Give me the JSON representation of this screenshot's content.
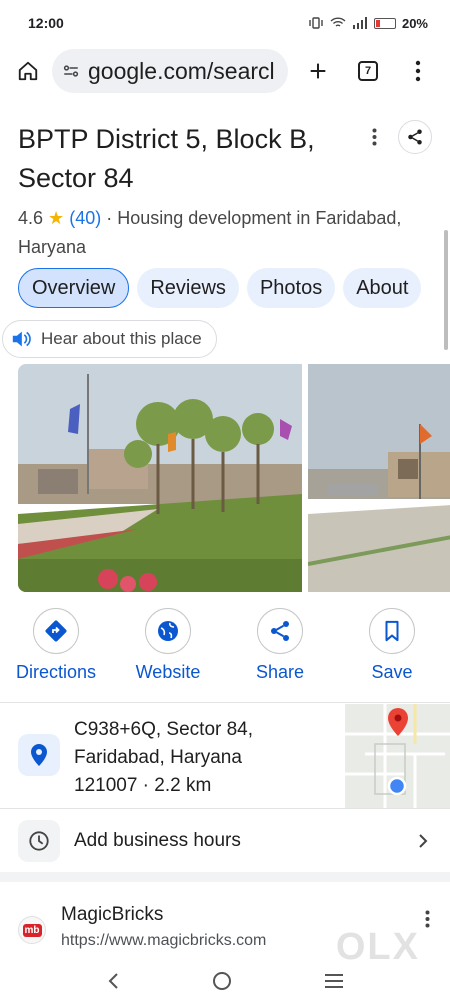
{
  "status_bar": {
    "time": "12:00",
    "battery": "20%"
  },
  "browser": {
    "url": "google.com/searcl",
    "tab_count": "7"
  },
  "place": {
    "title": "BPTP District 5, Block B, Sector 84",
    "rating": "4.6",
    "review_count": "(40)",
    "category": "· Housing development in Faridabad, Haryana"
  },
  "tabs": [
    "Overview",
    "Reviews",
    "Photos",
    "About"
  ],
  "hear_label": "Hear about this place",
  "actions": [
    "Directions",
    "Website",
    "Share",
    "Save"
  ],
  "address": {
    "line1": "C938+6Q, Sector 84,",
    "line2": "Faridabad, Haryana",
    "line3": "121007 · 2.2 km"
  },
  "hours_label": "Add business hours",
  "result": {
    "name": "MagicBricks",
    "url": "https://www.magicbricks.com",
    "logo_text": "mb"
  },
  "watermark": "OLX",
  "colors": {
    "accent": "#1a73e8",
    "action_text": "#0b57d0",
    "star": "#f4b400",
    "pin": "#ea4335"
  }
}
